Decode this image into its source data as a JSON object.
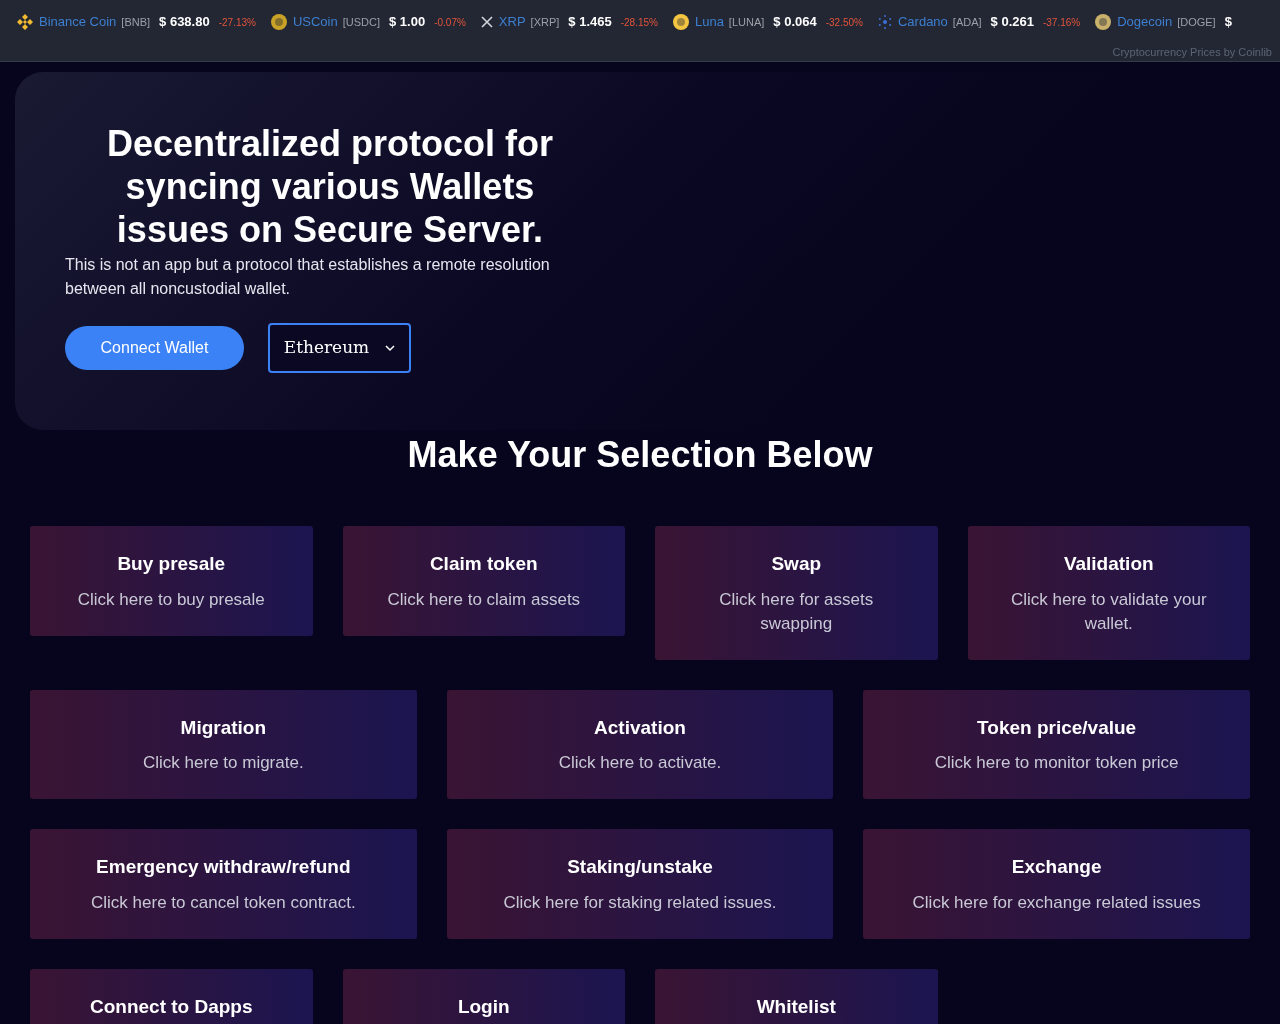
{
  "ticker": {
    "items": [
      {
        "name": "Binance Coin",
        "symbol": "[BNB]",
        "price": "$ 638.80",
        "change": "-27.13%"
      },
      {
        "name": "USCoin",
        "symbol": "[USDC]",
        "price": "$ 1.00",
        "change": "-0.07%"
      },
      {
        "name": "XRP",
        "symbol": "[XRP]",
        "price": "$ 1.465",
        "change": "-28.15%"
      },
      {
        "name": "Luna",
        "symbol": "[LUNA]",
        "price": "$ 0.064",
        "change": "-32.50%"
      },
      {
        "name": "Cardano",
        "symbol": "[ADA]",
        "price": "$ 0.261",
        "change": "-37.16%"
      },
      {
        "name": "Dogecoin",
        "symbol": "[DOGE]",
        "price": "$"
      }
    ],
    "credit": "Cryptocurrency Prices by Coinlib"
  },
  "hero": {
    "title": "Decentralized protocol for syncing various Wallets issues on Secure Server.",
    "description": "This is not an app but a protocol that establishes a remote resolution between all noncustodial wallet.",
    "button": "Connect Wallet",
    "network_select": "Ethereum"
  },
  "section_title": "Make Your Selection Below",
  "card_rows": [
    [
      {
        "title": "Buy presale",
        "subtitle": "Click here to buy presale"
      },
      {
        "title": "Claim token",
        "subtitle": "Click here to claim assets"
      },
      {
        "title": "Swap",
        "subtitle": "Click here for assets swapping"
      },
      {
        "title": "Validation",
        "subtitle": "Click here to validate your wallet."
      }
    ],
    [
      {
        "title": "Migration",
        "subtitle": "Click here to migrate."
      },
      {
        "title": "Activation",
        "subtitle": "Click here to activate."
      },
      {
        "title": "Token price/value",
        "subtitle": "Click here to monitor token price"
      }
    ],
    [
      {
        "title": "Emergency withdraw/refund",
        "subtitle": "Click here to cancel token contract."
      },
      {
        "title": "Staking/unstake",
        "subtitle": "Click here for staking related issues."
      },
      {
        "title": "Exchange",
        "subtitle": "Click here for exchange related issues"
      }
    ],
    [
      {
        "title": "Connect to Dapps"
      },
      {
        "title": "Login"
      },
      {
        "title": "Whitelist"
      }
    ]
  ]
}
